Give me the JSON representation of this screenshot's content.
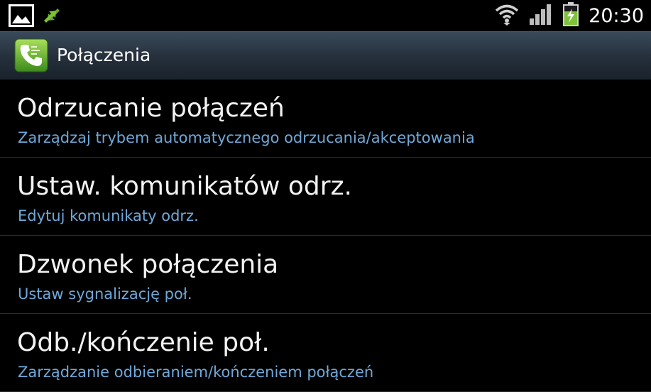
{
  "status_bar": {
    "left_icons": [
      "gallery-notification-icon",
      "sync-arrows-icon"
    ],
    "right_icons": [
      "wifi-icon",
      "signal-icon",
      "battery-charging-icon"
    ],
    "time": "20:30",
    "accent": "#7ec23a"
  },
  "action_bar": {
    "icon": "phone-icon",
    "title": "Połączenia"
  },
  "settings": {
    "items": [
      {
        "title": "Odrzucanie połączeń",
        "subtitle": "Zarządzaj trybem automatycznego odrzucania/akceptowania"
      },
      {
        "title": "Ustaw. komunikatów odrz.",
        "subtitle": "Edytuj komunikaty odrz."
      },
      {
        "title": "Dzwonek połączenia",
        "subtitle": "Ustaw sygnalizację poł."
      },
      {
        "title": "Odb./kończenie poł.",
        "subtitle": "Zarządzanie odbieraniem/kończeniem połączeń"
      }
    ]
  },
  "colors": {
    "background": "#000000",
    "subtitle": "#6fa8d8",
    "action_bar": "#26313d"
  }
}
